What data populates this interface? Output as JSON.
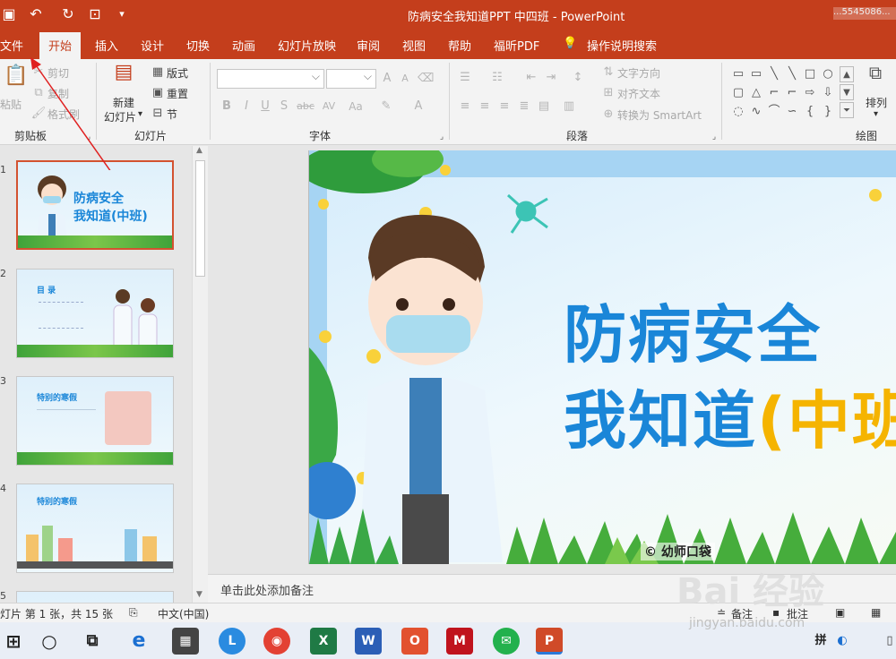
{
  "titlebar": {
    "doc_title": "防病安全我知道PPT 中四班  -  PowerPoint",
    "account": "...5545086..."
  },
  "tabs": [
    "文件",
    "开始",
    "插入",
    "设计",
    "切换",
    "动画",
    "幻灯片放映",
    "审阅",
    "视图",
    "帮助",
    "福昕PDF"
  ],
  "tell_me": "操作说明搜索",
  "ribbon": {
    "clipboard": {
      "paste": "粘贴",
      "cut": "剪切",
      "copy": "复制",
      "format_painter": "格式刷",
      "label": "剪贴板"
    },
    "slides": {
      "new_slide_1": "新建",
      "new_slide_2": "幻灯片",
      "layout": "版式",
      "reset": "重置",
      "section": "节",
      "label": "幻灯片"
    },
    "font": {
      "label": "字体"
    },
    "paragraph": {
      "text_direction": "文字方向",
      "align_text": "对齐文本",
      "smartart": "转换为 SmartArt",
      "label": "段落"
    },
    "drawing": {
      "arrange": "排列",
      "label": "绘图"
    }
  },
  "thumbnails": [
    {
      "num": "1",
      "title_1": "防病安全",
      "title_2": "我知道(中班)"
    },
    {
      "num": "2",
      "title": "目 录"
    },
    {
      "num": "3",
      "title": "特别的寒假"
    },
    {
      "num": "4",
      "title": "特别的寒假"
    },
    {
      "num": "5",
      "title": ""
    }
  ],
  "slide": {
    "title_line1": "防病安全",
    "title_line2_main": "我知道",
    "title_line2_accent": "(中班",
    "credit": "©  幼师口袋"
  },
  "notes_placeholder": "单击此处添加备注",
  "status": {
    "slide_info": "灯片 第 1 张，共 15 张",
    "language": "中文(中国)",
    "notes": "备注",
    "comments": "批注"
  },
  "watermark": {
    "main": "Bai 经验",
    "sub": "jingyan.baidu.com"
  },
  "colors": {
    "accent": "#c43e1c",
    "title_blue": "#1a86d8",
    "title_yellow": "#f5b400"
  }
}
